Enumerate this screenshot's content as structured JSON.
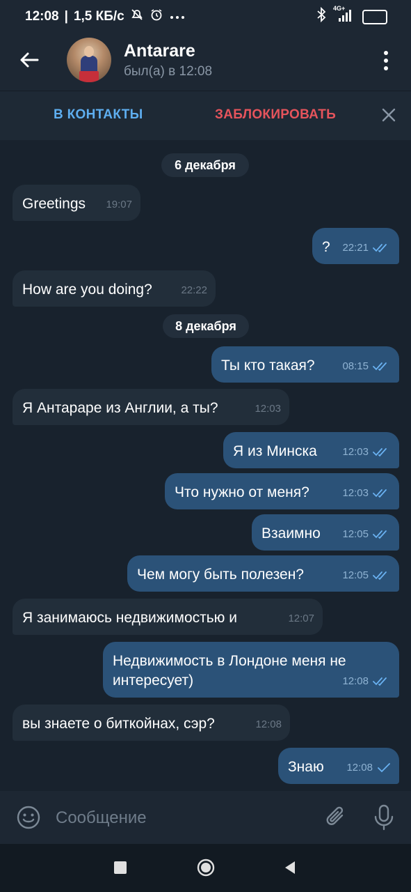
{
  "status_bar": {
    "time": "12:08",
    "separator": "|",
    "speed": "1,5 КБ/с",
    "network": "4G+",
    "battery": "84"
  },
  "header": {
    "name": "Antarare",
    "status": "был(а) в 12:08"
  },
  "actions": {
    "add_contact": "В КОНТАКТЫ",
    "block": "ЗАБЛОКИРОВАТЬ"
  },
  "messages": [
    {
      "type": "date",
      "text": "6 декабря"
    },
    {
      "type": "in",
      "text": "Greetings",
      "time": "19:07"
    },
    {
      "type": "out",
      "text": "?",
      "time": "22:21",
      "status": "read"
    },
    {
      "type": "in",
      "text": "How are you doing?",
      "time": "22:22"
    },
    {
      "type": "date",
      "text": "8 декабря"
    },
    {
      "type": "out",
      "text": "Ты кто такая?",
      "time": "08:15",
      "status": "read"
    },
    {
      "type": "in",
      "text": "Я Антараре из Англии, а ты?",
      "time": "12:03"
    },
    {
      "type": "out",
      "text": "Я из Минска",
      "time": "12:03",
      "status": "read"
    },
    {
      "type": "out",
      "text": "Что нужно от меня?",
      "time": "12:03",
      "status": "read"
    },
    {
      "type": "out",
      "text": "Взаимно",
      "time": "12:05",
      "status": "read"
    },
    {
      "type": "out",
      "text": "Чем могу быть полезен?",
      "time": "12:05",
      "status": "read"
    },
    {
      "type": "in",
      "text": "Я занимаюсь недвижимостью и",
      "time": "12:07"
    },
    {
      "type": "out",
      "text": "Недвижимость в Лондоне меня не интересует)",
      "time": "12:08",
      "status": "read"
    },
    {
      "type": "in",
      "text": "вы знаете о биткойнах, сэр?",
      "time": "12:08"
    },
    {
      "type": "out",
      "text": "Знаю",
      "time": "12:08",
      "status": "sent"
    }
  ],
  "composer": {
    "placeholder": "Сообщение"
  },
  "icons": {
    "back": "arrow-left-icon",
    "menu": "more-vertical-icon",
    "close": "close-icon",
    "emoji": "emoji-icon",
    "attach": "paperclip-icon",
    "mic": "microphone-icon",
    "read": "double-check-icon",
    "sent": "single-check-icon"
  },
  "colors": {
    "background": "#18222d",
    "header": "#1d2733",
    "incoming_bubble": "#222e3a",
    "outgoing_bubble": "#2b5278",
    "accent_blue": "#5eaef0",
    "danger_red": "#e6545c"
  }
}
